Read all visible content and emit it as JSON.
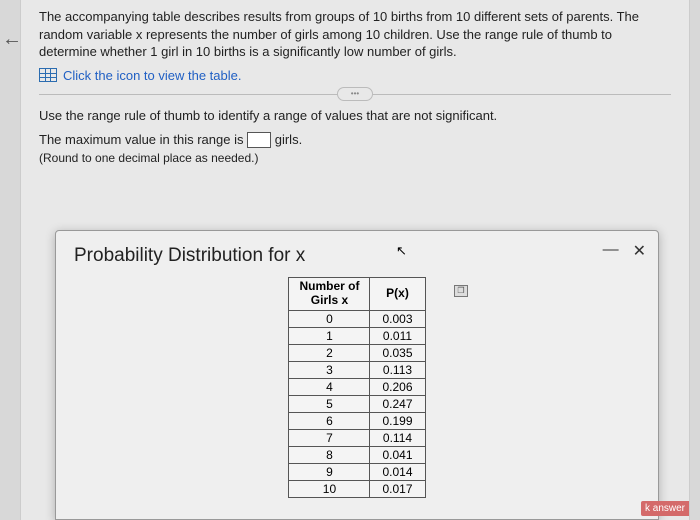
{
  "intro": "The accompanying table describes results from groups of 10 births from 10 different sets of parents. The random variable x represents the number of girls among 10 children. Use the range rule of thumb to determine whether 1 girl in 10 births is a significantly low number of girls.",
  "table_link_text": "Click the icon to view the table.",
  "divider_label": "•••",
  "prompt": "Use the range rule of thumb to identify a range of values that are not significant.",
  "answer_prefix": "The maximum value in this range is",
  "answer_suffix": "girls.",
  "hint": "(Round to one decimal place as needed.)",
  "modal": {
    "title": "Probability Distribution for x",
    "minimize": "—",
    "close": "✕",
    "copy": "❐"
  },
  "chart_data": {
    "type": "table",
    "columns": [
      "Number of Girls x",
      "P(x)"
    ],
    "rows": [
      [
        "0",
        "0.003"
      ],
      [
        "1",
        "0.011"
      ],
      [
        "2",
        "0.035"
      ],
      [
        "3",
        "0.113"
      ],
      [
        "4",
        "0.206"
      ],
      [
        "5",
        "0.247"
      ],
      [
        "6",
        "0.199"
      ],
      [
        "7",
        "0.114"
      ],
      [
        "8",
        "0.041"
      ],
      [
        "9",
        "0.014"
      ],
      [
        "10",
        "0.017"
      ]
    ]
  },
  "badge": "k answer"
}
